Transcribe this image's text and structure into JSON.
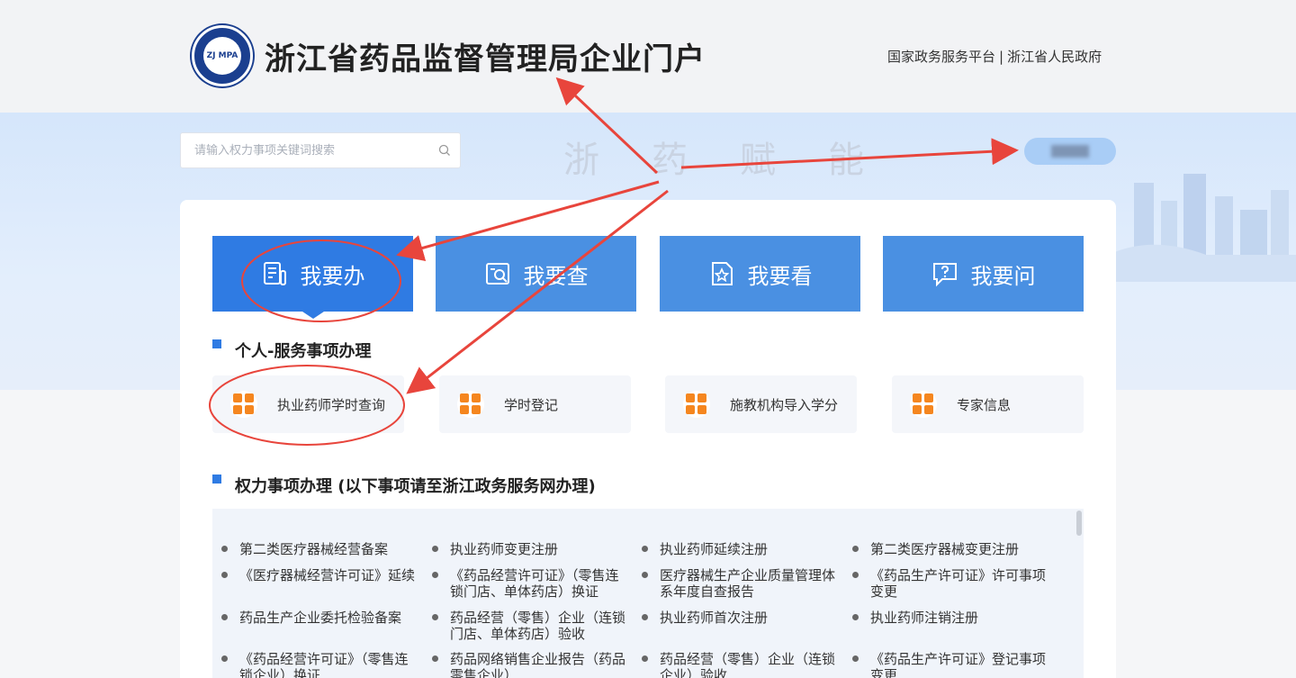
{
  "header": {
    "logo_text": "ZJ MPA",
    "title": "浙江省药品监督管理局企业门户",
    "link_national": "国家政务服务平台",
    "link_separator": "|",
    "link_province": "浙江省人民政府"
  },
  "search": {
    "placeholder": "请输入权力事项关键词搜索"
  },
  "banner": {
    "slogan": "浙药赋能"
  },
  "tabs": [
    {
      "label": "我要办",
      "icon": "document-icon"
    },
    {
      "label": "我要查",
      "icon": "search-doc-icon"
    },
    {
      "label": "我要看",
      "icon": "star-doc-icon"
    },
    {
      "label": "我要问",
      "icon": "question-chat-icon"
    }
  ],
  "personal": {
    "title": "个人-服务事项办理",
    "items": [
      "执业药师学时查询",
      "学时登记",
      "施教机构导入学分",
      "专家信息"
    ]
  },
  "authority": {
    "title": "权力事项办理 (以下事项请至浙江政务服务网办理)",
    "items": [
      "第二类医疗器械经营备案",
      "执业药师变更注册",
      "执业药师延续注册",
      "第二类医疗器械变更注册",
      "《医疗器械经营许可证》延续",
      "《药品经营许可证》（零售连锁门店、单体药店）换证",
      "医疗器械生产企业质量管理体系年度自查报告",
      "《药品生产许可证》许可事项变更",
      "药品生产企业委托检验备案",
      "药品经营（零售）企业（连锁门店、单体药店）验收",
      "执业药师首次注册",
      "执业药师注销注册",
      "《药品经营许可证》（零售连锁企业）换证",
      "药品网络销售企业报告（药品零售企业）",
      "药品经营（零售）企业（连锁企业）验收",
      "《药品生产许可证》登记事项变更"
    ]
  },
  "colors": {
    "primary": "#2f7be3",
    "tab": "#4a90e2",
    "accent_orange": "#f5861f",
    "annotation_red": "#e8453c"
  }
}
